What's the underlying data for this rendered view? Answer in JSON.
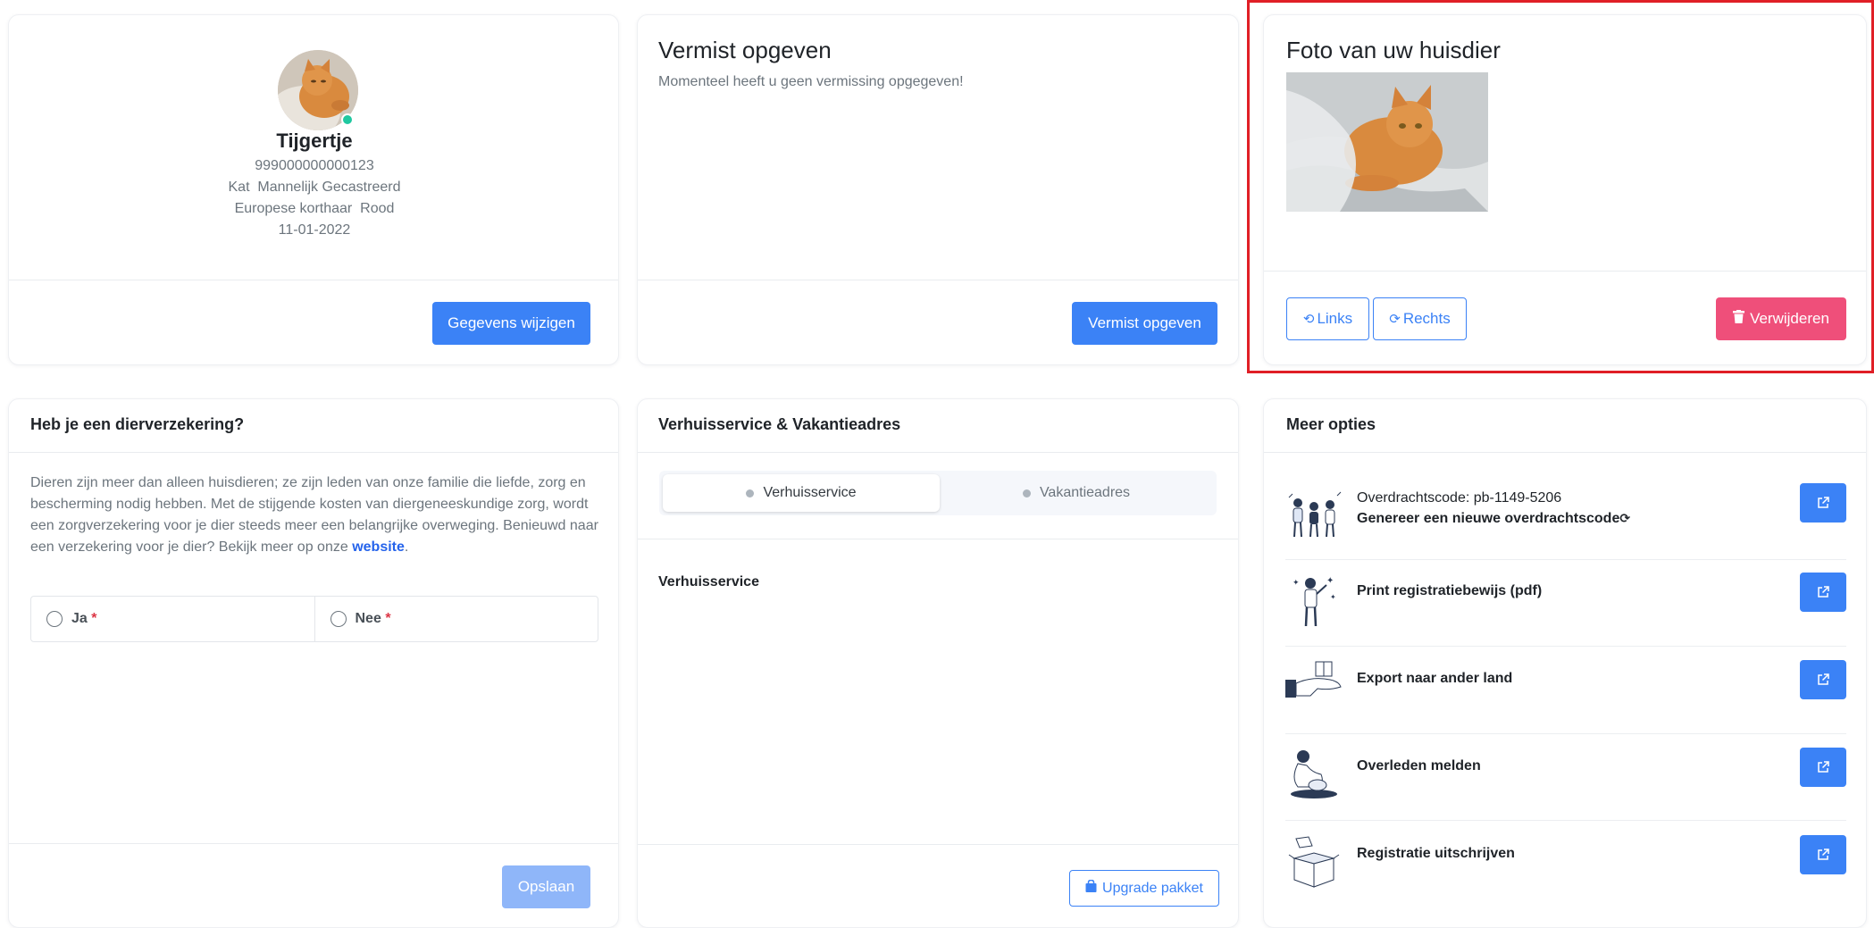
{
  "pet_card": {
    "name": "Tijgertje",
    "chip": "999000000000123",
    "line_species": "Kat  Mannelijk Gecastreerd",
    "line_breed": "Europese korthaar  Rood",
    "birthdate": "11-01-2022",
    "edit_button": "Gegevens wijzigen"
  },
  "missing_card": {
    "title": "Vermist opgeven",
    "message": "Momenteel heeft u geen vermissing opgegeven!",
    "button": "Vermist opgeven"
  },
  "photo_card": {
    "title": "Foto van uw huisdier",
    "rotate_left": "Links",
    "rotate_right": "Rechts",
    "delete": "Verwijderen"
  },
  "insurance_card": {
    "title": "Heb je een dierverzekering?",
    "body": "Dieren zijn meer dan alleen huisdieren; ze zijn leden van onze familie die liefde, zorg en bescherming nodig hebben. Met de stijgende kosten van diergeneeskundige zorg, wordt een zorgverzekering voor je dier steeds meer een belangrijke overweging. Benieuwd naar een verzekering voor je dier? Bekijk meer op onze",
    "link": "website",
    "link_suffix": ".",
    "option_yes": "Ja",
    "option_no": "Nee",
    "required_mark": "*",
    "save": "Opslaan"
  },
  "moving_card": {
    "title": "Verhuisservice & Vakantieadres",
    "tabs": [
      {
        "label": "Verhuisservice",
        "active": true
      },
      {
        "label": "Vakantieadres",
        "active": false
      }
    ],
    "section_title": "Verhuisservice",
    "upgrade": "Upgrade pakket"
  },
  "options_card": {
    "title": "Meer opties",
    "items": [
      {
        "line1": "Overdrachtscode: pb-1149-5206",
        "line2": "Genereer een nieuwe overdrachtscode",
        "icon": "people-group-icon"
      },
      {
        "line1": "Print registratiebewijs (pdf)",
        "icon": "person-stars-icon"
      },
      {
        "line1": "Export naar ander land",
        "icon": "hand-box-icon"
      },
      {
        "line1": "Overleden melden",
        "icon": "sitting-person-icon"
      },
      {
        "line1": "Registratie uitschrijven",
        "icon": "open-box-icon"
      }
    ]
  },
  "colors": {
    "primary": "#3b82f6",
    "danger": "#ef4f7a",
    "online": "#1fc8a0",
    "highlight": "#e01f26"
  }
}
